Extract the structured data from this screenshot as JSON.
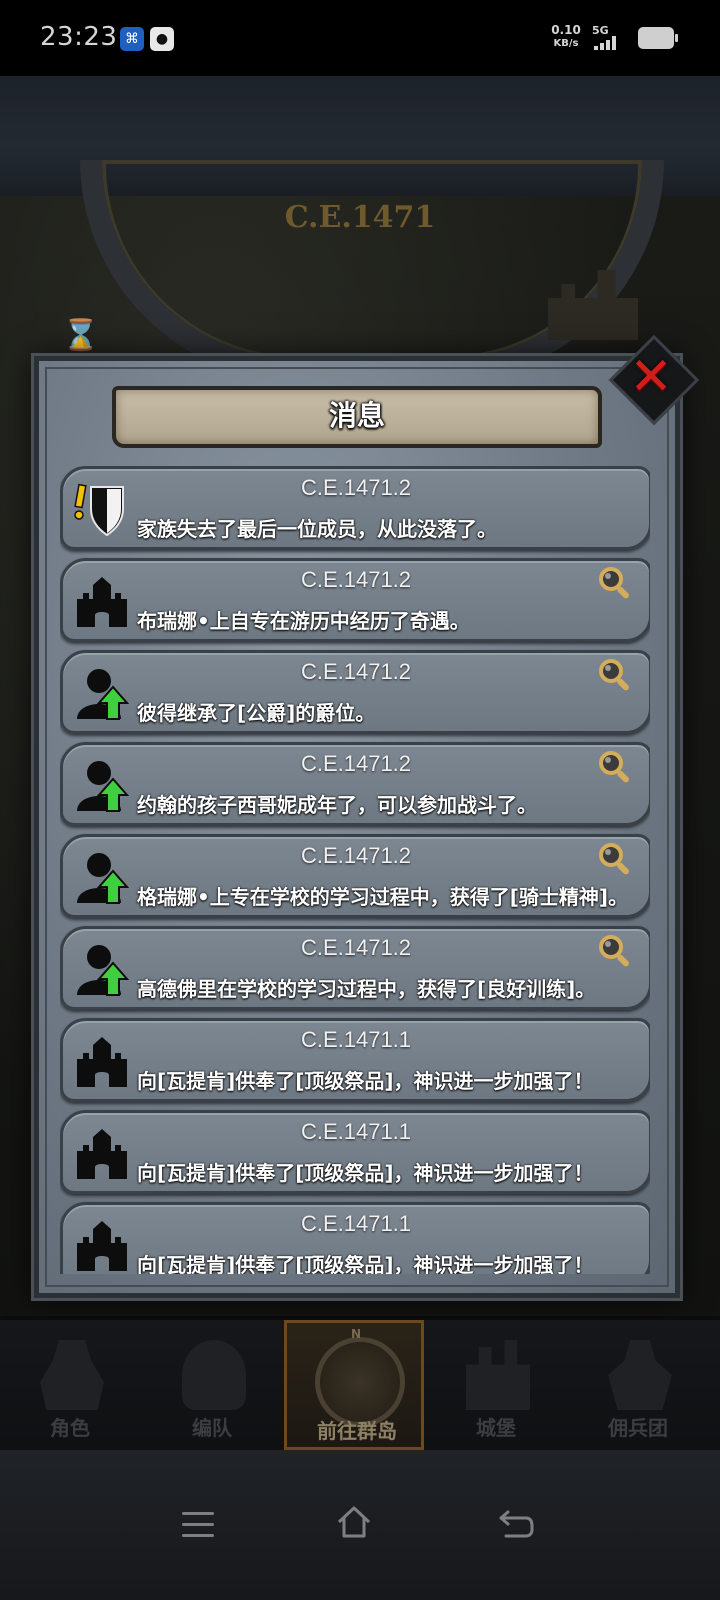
{
  "status_bar": {
    "time": "23:23",
    "speed_value": "0.10",
    "speed_unit": "KB/s",
    "network": "5G"
  },
  "background": {
    "year_dial": "C.E.1471"
  },
  "dialog": {
    "title": "消息",
    "close_glyph": "✕"
  },
  "messages": [
    {
      "date": "C.E.1471.2",
      "text": "家族失去了最后一位成员，从此没落了。",
      "icon": "shield-alert-icon",
      "has_search": false
    },
    {
      "date": "C.E.1471.2",
      "text": "布瑞娜•上自专在游历中经历了奇遇。",
      "icon": "castle-icon",
      "has_search": true
    },
    {
      "date": "C.E.1471.2",
      "text": "彼得继承了[公爵]的爵位。",
      "icon": "person-up-icon",
      "has_search": true
    },
    {
      "date": "C.E.1471.2",
      "text": "约翰的孩子西哥妮成年了，可以参加战斗了。",
      "icon": "person-up-icon",
      "has_search": true
    },
    {
      "date": "C.E.1471.2",
      "text": "格瑞娜•上专在学校的学习过程中，获得了[骑士精神]。",
      "icon": "person-up-icon",
      "has_search": true
    },
    {
      "date": "C.E.1471.2",
      "text": "高德佛里在学校的学习过程中，获得了[良好训练]。",
      "icon": "person-up-icon",
      "has_search": true
    },
    {
      "date": "C.E.1471.1",
      "text": "向[瓦提肯]供奉了[顶级祭品]，神识进一步加强了！",
      "icon": "castle-icon",
      "has_search": false
    },
    {
      "date": "C.E.1471.1",
      "text": "向[瓦提肯]供奉了[顶级祭品]，神识进一步加强了！",
      "icon": "castle-icon",
      "has_search": false
    },
    {
      "date": "C.E.1471.1",
      "text": "向[瓦提肯]供奉了[顶级祭品]，神识进一步加强了！",
      "icon": "castle-icon",
      "has_search": false
    }
  ],
  "bottom_nav": [
    {
      "label": "角色",
      "icon": "knight-icon",
      "active": false
    },
    {
      "label": "编队",
      "icon": "helmet-icon",
      "active": false
    },
    {
      "label": "前往群岛",
      "icon": "compass-icon",
      "active": true
    },
    {
      "label": "城堡",
      "icon": "castle-icon",
      "active": false
    },
    {
      "label": "佣兵团",
      "icon": "mercenary-icon",
      "active": false
    }
  ],
  "compass_north": "N",
  "colors": {
    "accent_close": "#d21d1d",
    "new_arrow": "#3fcf3f",
    "search_gold": "#c9a35a"
  }
}
